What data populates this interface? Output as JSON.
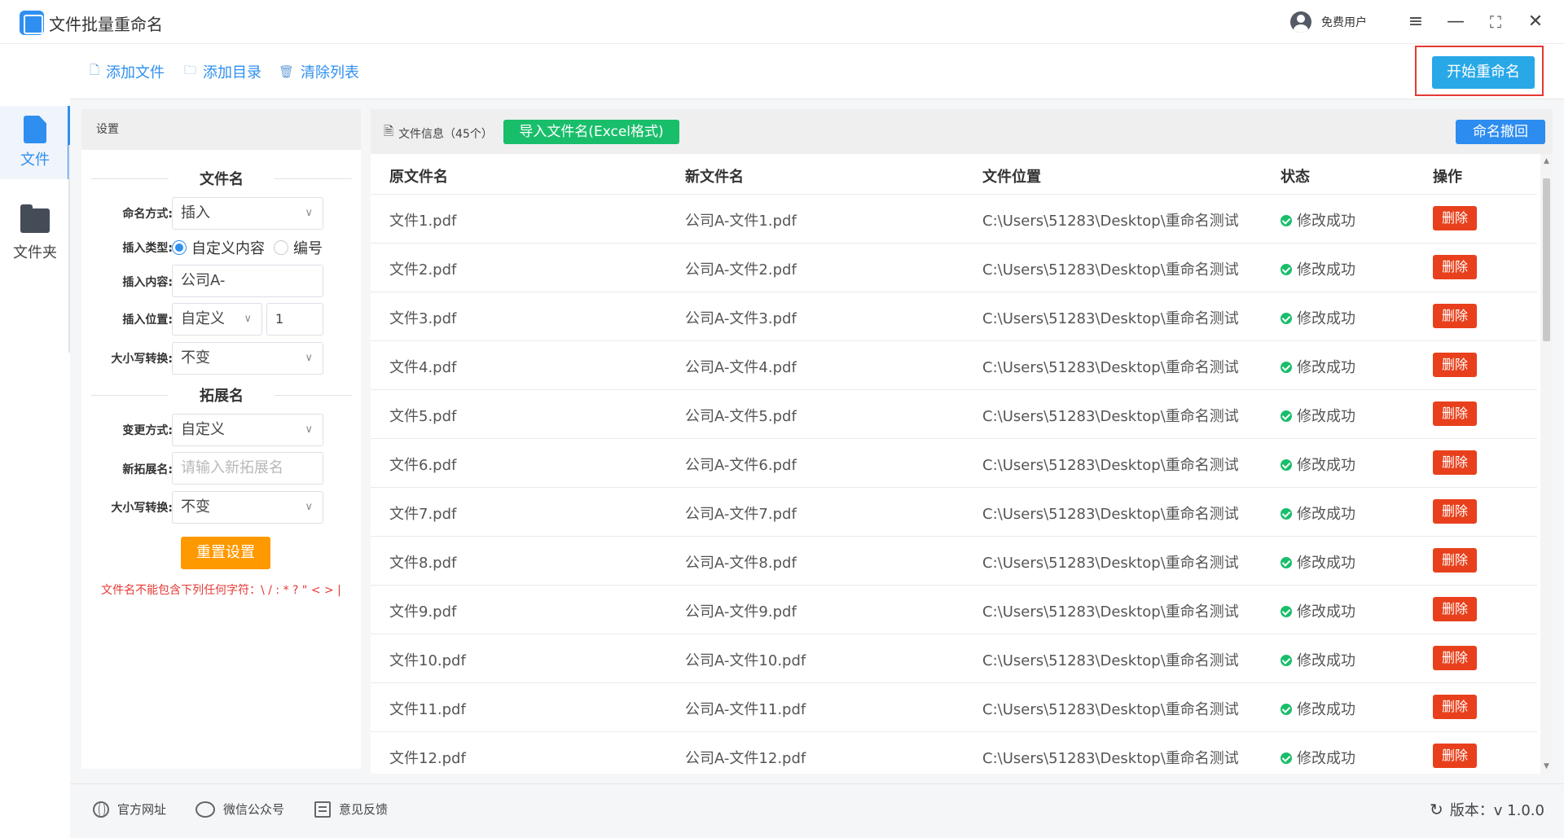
{
  "app": {
    "title": "文件批量重命名",
    "user_label": "免费用户"
  },
  "nav": [
    {
      "label": "文件"
    },
    {
      "label": "文件夹"
    }
  ],
  "toolbar": {
    "add_file": "添加文件",
    "add_dir": "添加目录",
    "clear_list": "清除列表",
    "start": "开始重命名"
  },
  "settings": {
    "header": "设置",
    "section_name": "文件名",
    "section_ext": "拓展名",
    "naming_mode_label": "命名方式:",
    "naming_mode_value": "插入",
    "insert_type_label": "插入类型:",
    "insert_type_options": [
      "自定义内容",
      "编号"
    ],
    "insert_content_label": "插入内容:",
    "insert_content_value": "公司A-",
    "insert_pos_label": "插入位置:",
    "insert_pos_value": "自定义",
    "insert_pos_index": "1",
    "case_label": "大小写转换:",
    "case_value": "不变",
    "ext_mode_label": "变更方式:",
    "ext_mode_value": "自定义",
    "new_ext_label": "新拓展名:",
    "new_ext_placeholder": "请输入新拓展名",
    "ext_case_label": "大小写转换:",
    "ext_case_value": "不变",
    "reset_label": "重置设置",
    "warning": "文件名不能包含下列任何字符：\\ / : * ? \" < > |"
  },
  "files": {
    "info_label": "文件信息（45个）",
    "import_label": "导入文件名(Excel格式)",
    "undo_label": "命名撤回",
    "columns": [
      "原文件名",
      "新文件名",
      "文件位置",
      "状态",
      "操作"
    ],
    "delete_label": "删除",
    "rows": [
      {
        "orig": "文件1.pdf",
        "new": "公司A-文件1.pdf",
        "path": "C:\\Users\\51283\\Desktop\\重命名测试",
        "status": "修改成功"
      },
      {
        "orig": "文件2.pdf",
        "new": "公司A-文件2.pdf",
        "path": "C:\\Users\\51283\\Desktop\\重命名测试",
        "status": "修改成功"
      },
      {
        "orig": "文件3.pdf",
        "new": "公司A-文件3.pdf",
        "path": "C:\\Users\\51283\\Desktop\\重命名测试",
        "status": "修改成功"
      },
      {
        "orig": "文件4.pdf",
        "new": "公司A-文件4.pdf",
        "path": "C:\\Users\\51283\\Desktop\\重命名测试",
        "status": "修改成功"
      },
      {
        "orig": "文件5.pdf",
        "new": "公司A-文件5.pdf",
        "path": "C:\\Users\\51283\\Desktop\\重命名测试",
        "status": "修改成功"
      },
      {
        "orig": "文件6.pdf",
        "new": "公司A-文件6.pdf",
        "path": "C:\\Users\\51283\\Desktop\\重命名测试",
        "status": "修改成功"
      },
      {
        "orig": "文件7.pdf",
        "new": "公司A-文件7.pdf",
        "path": "C:\\Users\\51283\\Desktop\\重命名测试",
        "status": "修改成功"
      },
      {
        "orig": "文件8.pdf",
        "new": "公司A-文件8.pdf",
        "path": "C:\\Users\\51283\\Desktop\\重命名测试",
        "status": "修改成功"
      },
      {
        "orig": "文件9.pdf",
        "new": "公司A-文件9.pdf",
        "path": "C:\\Users\\51283\\Desktop\\重命名测试",
        "status": "修改成功"
      },
      {
        "orig": "文件10.pdf",
        "new": "公司A-文件10.pdf",
        "path": "C:\\Users\\51283\\Desktop\\重命名测试",
        "status": "修改成功"
      },
      {
        "orig": "文件11.pdf",
        "new": "公司A-文件11.pdf",
        "path": "C:\\Users\\51283\\Desktop\\重命名测试",
        "status": "修改成功"
      },
      {
        "orig": "文件12.pdf",
        "new": "公司A-文件12.pdf",
        "path": "C:\\Users\\51283\\Desktop\\重命名测试",
        "status": "修改成功"
      }
    ]
  },
  "footer": {
    "website": "官方网址",
    "wechat": "微信公众号",
    "feedback": "意见反馈",
    "version": "版本：v 1.0.0"
  },
  "colors": {
    "accent": "#2f8ff0",
    "start_button": "#29a8e8",
    "import_button": "#19be6b",
    "delete_button": "#e8401c",
    "reset_button": "#ff9900",
    "highlight_outline": "#e53935"
  }
}
